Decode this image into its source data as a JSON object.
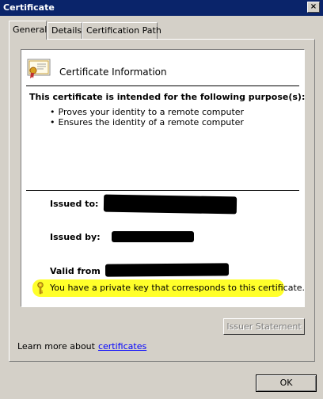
{
  "window": {
    "title": "Certificate",
    "close_label": "×"
  },
  "tabs": [
    {
      "label": "General",
      "active": true
    },
    {
      "label": "Details",
      "active": false
    },
    {
      "label": "Certification Path",
      "active": false
    }
  ],
  "cert": {
    "info_title": "Certificate Information",
    "purpose_heading": "This certificate is intended for the following purpose(s):",
    "purposes": [
      "Proves your identity to a remote computer",
      "Ensures the identity of a remote computer"
    ],
    "issued_to_label": "Issued to:",
    "issued_by_label": "Issued by:",
    "valid_from_label": "Valid from",
    "private_key_text": "You have a private key that corresponds to this certificate.",
    "highlight_color": "#ffff2a",
    "icons": {
      "cert": "certificate-icon",
      "key": "key-icon"
    }
  },
  "buttons": {
    "issuer_statement": "Issuer Statement",
    "ok": "OK"
  },
  "learn_more": {
    "prefix": "Learn more about",
    "link": "certificates"
  }
}
